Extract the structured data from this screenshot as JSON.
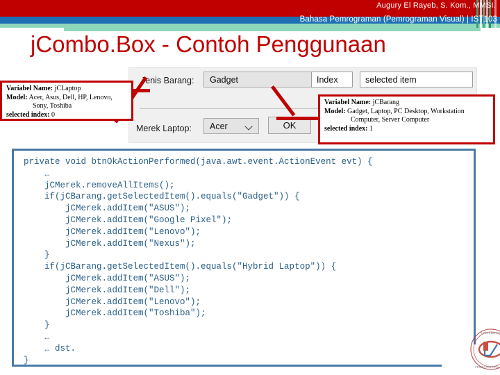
{
  "header": {
    "lecturer": "Augury El Rayeb, S. Kom., MMSI.",
    "course": "Bahasa Pemrograman (Pemrograman Visual) | IST103"
  },
  "title": "jCombo.Box - Contoh Penggunaan",
  "form": {
    "label_jenis_barang": "Jenis Barang:",
    "label_merek_laptop": "Merek Laptop:",
    "combo_barang_value": "Gadget",
    "combo_merek_value": "Acer",
    "field_index_value": "Index",
    "field_selected_value": "selected item",
    "ok_button": "OK"
  },
  "callout_left": {
    "variabel_label": "Variabel Name:",
    "variabel_value": "jCLaptop",
    "model_label": "Model:",
    "model_value": "Acer, Asus, Dell, HP, Lenovo,",
    "model_value2": "Sony, Toshiba",
    "index_label": "selected index:",
    "index_value": "0"
  },
  "callout_right": {
    "variabel_label": "Variabel Name:",
    "variabel_value": "jCBarang",
    "model_label": "Model:",
    "model_value": "Gadget, Laptop, PC Desktop, Workstation",
    "model_value2": "Computer, Server Computer",
    "index_label": "selected index:",
    "index_value": "1"
  },
  "code": {
    "lines": [
      "private void btnOkActionPerformed(java.awt.event.ActionEvent evt) {",
      "    …",
      "    jCMerek.removeAllItems();",
      "    if(jCBarang.getSelectedItem().equals(\"Gadget\")) {",
      "        jCMerek.addItem(\"ASUS\");",
      "        jCMerek.addItem(\"Google Pixel\");",
      "        jCMerek.addItem(\"Lenovo\");",
      "        jCMerek.addItem(\"Nexus\");",
      "    }",
      "    if(jCBarang.getSelectedItem().equals(\"Hybrid Laptop\")) {",
      "        jCMerek.addItem(\"ASUS\");",
      "        jCMerek.addItem(\"Dell\");",
      "        jCMerek.addItem(\"Lenovo\");",
      "        jCMerek.addItem(\"Toshiba\");",
      "    }",
      "    …",
      "    … dst.",
      "}"
    ]
  },
  "colors": {
    "banner_red": "#c00000",
    "banner_blue": "#1f6fb5",
    "banner_mint": "#8fd7bb",
    "title_red": "#c00000",
    "callout_border": "#c00000",
    "code_border": "#4a7aa7",
    "code_text": "#2a5f87"
  }
}
